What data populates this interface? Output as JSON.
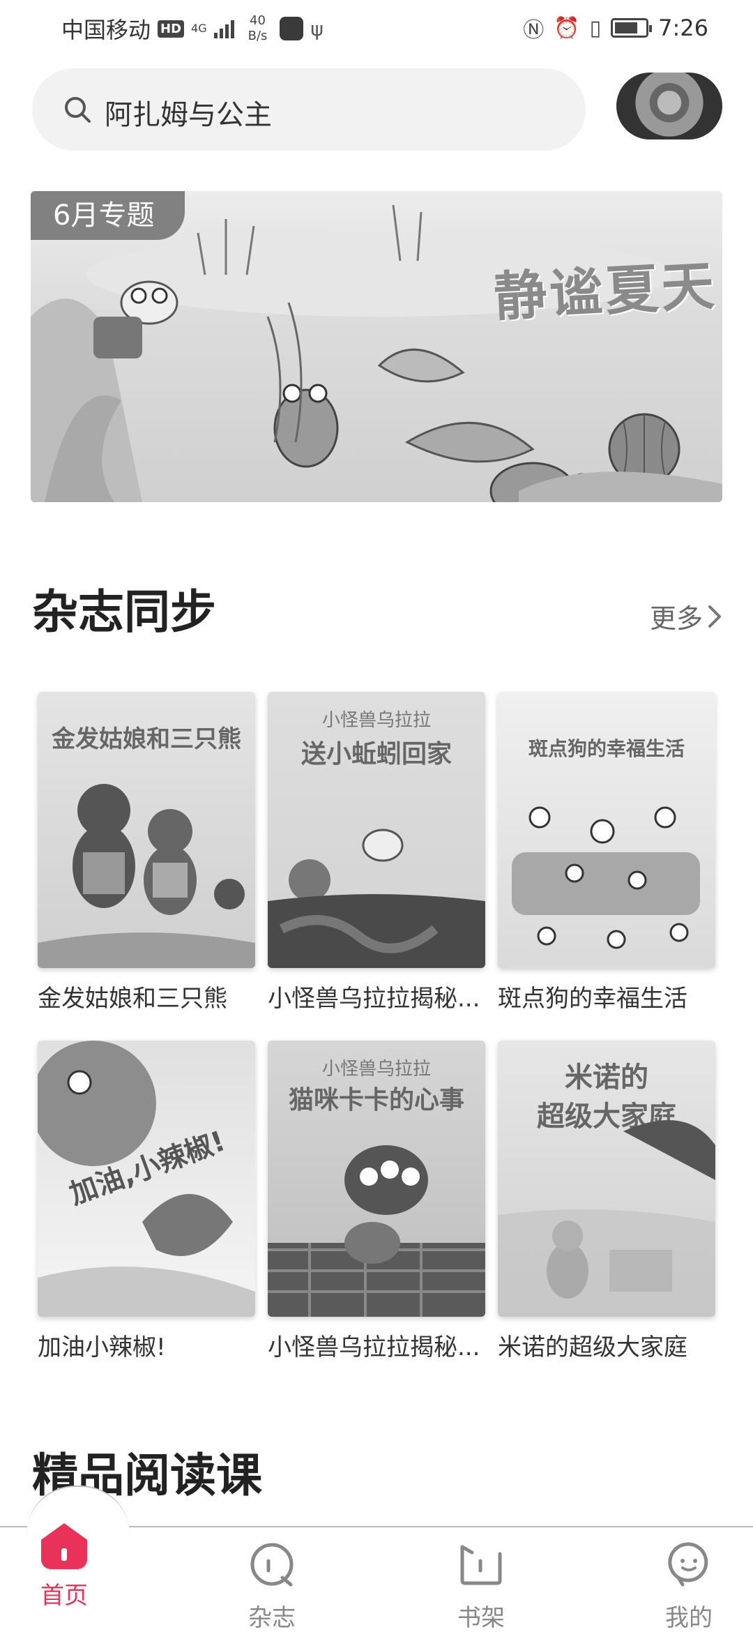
{
  "status_bar": {
    "carrier": "中国移动",
    "hd_badge": "HD",
    "network": "4G",
    "speed_value": "40",
    "speed_unit": "B/s",
    "time": "7:26",
    "battery_level": 0.75
  },
  "search": {
    "query": "阿扎姆与公主"
  },
  "banner": {
    "tag": "6月专题",
    "title": "静谧夏天"
  },
  "magazine_section": {
    "title": "杂志同步",
    "more_label": "更多",
    "books": [
      {
        "label": "金发姑娘和三只熊",
        "cover_title": "金发姑娘和三只熊"
      },
      {
        "label": "小怪兽乌拉拉揭秘...",
        "cover_sub": "小怪兽乌拉拉",
        "cover_title": "送小蚯蚓回家"
      },
      {
        "label": "斑点狗的幸福生活",
        "cover_title": "斑点狗的幸福生活"
      },
      {
        "label": "加油小辣椒!",
        "cover_title": "加油,小辣椒!"
      },
      {
        "label": "小怪兽乌拉拉揭秘...",
        "cover_sub": "小怪兽乌拉拉",
        "cover_title": "猫咪卡卡的心事"
      },
      {
        "label": "米诺的超级大家庭",
        "cover_title": "米诺的",
        "cover_title_line2": "超级大家庭"
      }
    ]
  },
  "reading_section": {
    "title": "精品阅读课"
  },
  "tabbar": {
    "items": [
      {
        "label": "首页",
        "icon": "home-icon",
        "active": true
      },
      {
        "label": "杂志",
        "icon": "magazine-icon",
        "active": false
      },
      {
        "label": "书架",
        "icon": "bookshelf-icon",
        "active": false
      },
      {
        "label": "我的",
        "icon": "profile-icon",
        "active": false
      }
    ]
  },
  "colors": {
    "accent": "#e8325a",
    "inactive": "#888888"
  }
}
